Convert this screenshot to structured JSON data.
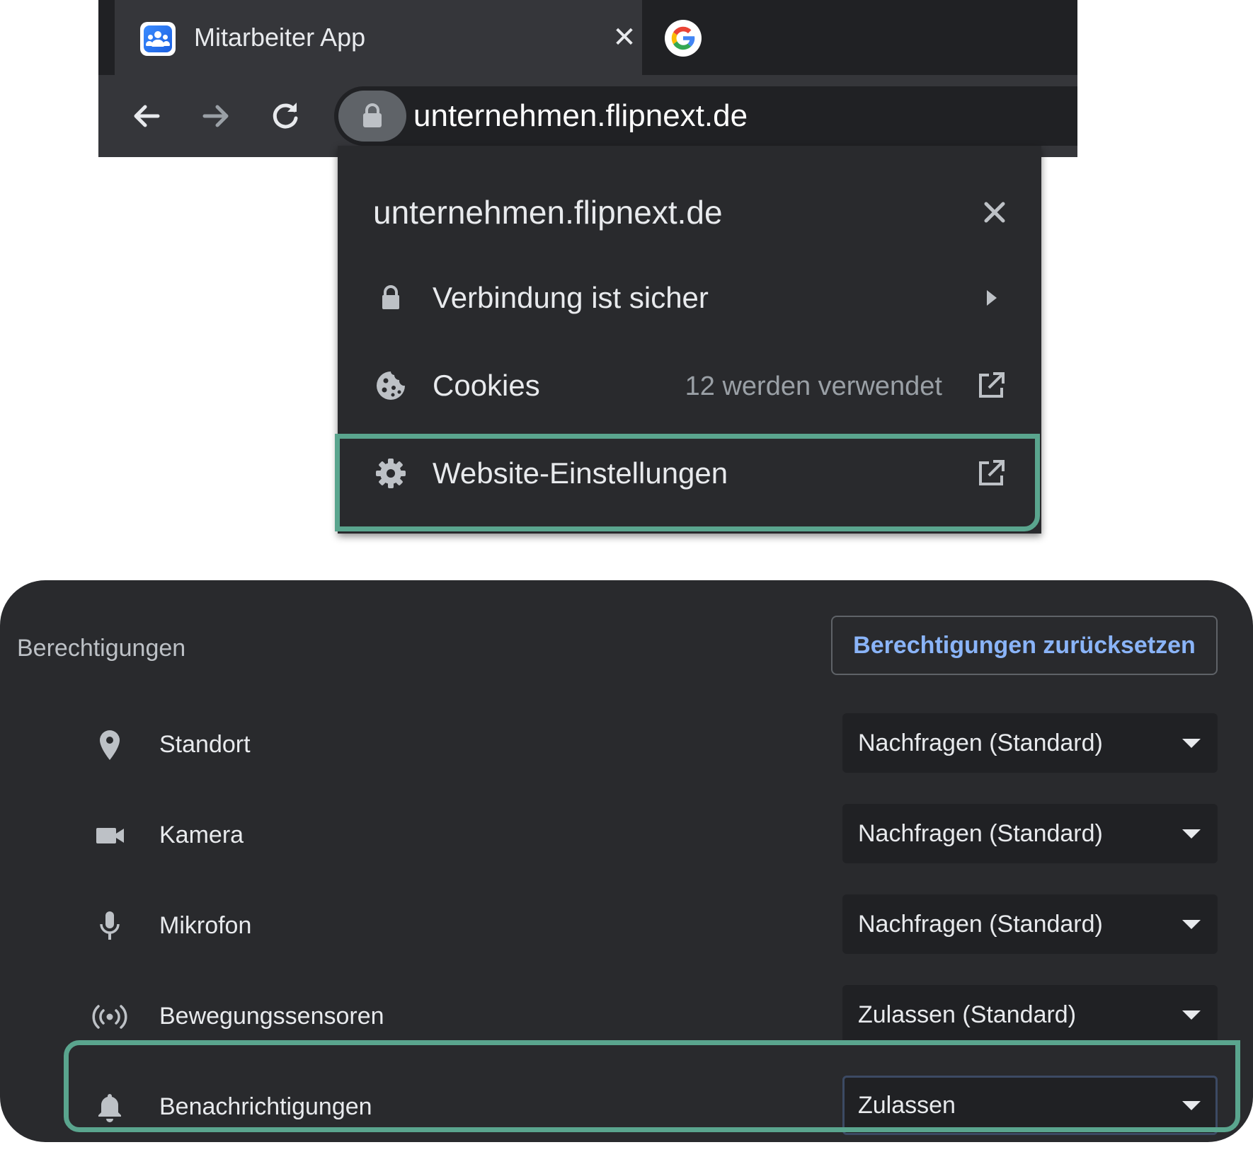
{
  "browser": {
    "tab": {
      "title": "Mitarbeiter App",
      "close_glyph": "✕"
    },
    "address_bar": {
      "url": "unternehmen.flipnext.de"
    },
    "icons": [
      "app-favicon",
      "google-favicon",
      "back-arrow-icon",
      "forward-arrow-icon",
      "reload-icon",
      "lock-icon"
    ]
  },
  "page_info_popup": {
    "title": "unternehmen.flipnext.de",
    "rows": [
      {
        "label": "Verbindung ist sicher",
        "icon": "lock-icon",
        "end_icon": "chevron-right-icon"
      },
      {
        "label": "Cookies",
        "sub": "12 werden verwendet",
        "icon": "cookie-icon",
        "end_icon": "open-external-icon"
      },
      {
        "label": "Website-Einstellungen",
        "icon": "gear-icon",
        "end_icon": "open-external-icon"
      }
    ]
  },
  "settings": {
    "heading": "Berechtigungen",
    "reset_button": "Berechtigungen zurücksetzen",
    "permissions": [
      {
        "label": "Standort",
        "value": "Nachfragen (Standard)",
        "icon": "location-pin-icon"
      },
      {
        "label": "Kamera",
        "value": "Nachfragen (Standard)",
        "icon": "camera-icon"
      },
      {
        "label": "Mikrofon",
        "value": "Nachfragen (Standard)",
        "icon": "microphone-icon"
      },
      {
        "label": "Bewegungssensoren",
        "value": "Zulassen (Standard)",
        "icon": "motion-sensor-icon"
      },
      {
        "label": "Benachrichtigungen",
        "value": "Zulassen",
        "icon": "bell-icon"
      }
    ]
  },
  "colors": {
    "highlight": "#5aa58e",
    "link_blue": "#8ab4f8",
    "panel_bg": "#292a2d",
    "chrome_bg": "#35363a"
  }
}
